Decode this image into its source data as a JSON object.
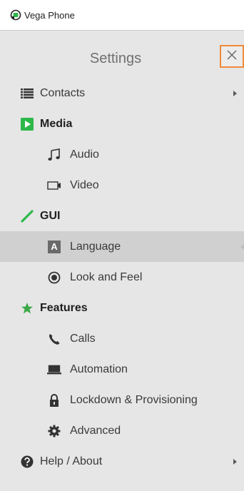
{
  "window": {
    "title": "Vega Phone"
  },
  "header": {
    "title": "Settings"
  },
  "nav": {
    "contacts": "Contacts",
    "media": "Media",
    "audio": "Audio",
    "video": "Video",
    "gui": "GUI",
    "language": "Language",
    "language_glyph": "A",
    "look_and_feel": "Look and Feel",
    "features": "Features",
    "calls": "Calls",
    "automation": "Automation",
    "lockdown": "Lockdown & Provisioning",
    "advanced": "Advanced",
    "help": "Help / About"
  },
  "colors": {
    "accent_close_border": "#ef8a3a",
    "media_icon": "#2db84a",
    "gui_icon": "#2db84a",
    "features_icon": "#3aa845",
    "selected_bg": "#d0d0d0"
  },
  "icons": {
    "contacts": "list-icon",
    "media": "play-icon",
    "audio": "music-note-icon",
    "video": "video-camera-icon",
    "gui": "pencil-icon",
    "language": "letter-a-icon",
    "look_and_feel": "radio-target-icon",
    "features": "star-icon",
    "calls": "phone-icon",
    "automation": "laptop-icon",
    "lockdown": "lock-icon",
    "advanced": "gear-icon",
    "help": "question-icon"
  },
  "selected_item": "Language"
}
